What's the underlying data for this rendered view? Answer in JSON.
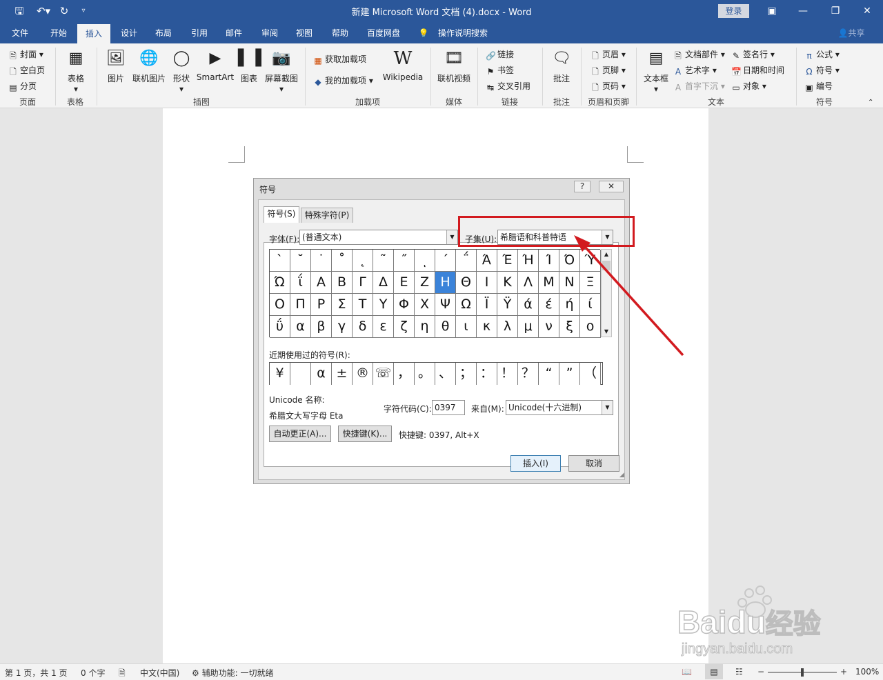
{
  "window": {
    "title": "新建 Microsoft Word 文档 (4).docx  -  Word",
    "login": "登录",
    "qat": {
      "save_icon": "save-icon",
      "undo_icon": "undo-icon",
      "redo_icon": "redo-icon",
      "customize_icon": "customize-qat-icon"
    },
    "controls": {
      "ribbon_display": "ribbon-display-icon",
      "minimize": "minimize-icon",
      "restore": "restore-icon",
      "close": "close-icon"
    }
  },
  "tabs": [
    "文件",
    "开始",
    "插入",
    "设计",
    "布局",
    "引用",
    "邮件",
    "审阅",
    "视图",
    "帮助",
    "百度网盘",
    "操作说明搜索"
  ],
  "share": "共享",
  "ribbon": {
    "pages": {
      "label": "页面",
      "cover": "封面",
      "blank": "空白页",
      "break": "分页"
    },
    "tables": {
      "label": "表格",
      "table": "表格"
    },
    "illustrations": {
      "label": "插图",
      "picture": "图片",
      "online_picture": "联机图片",
      "shapes": "形状",
      "smartart": "SmartArt",
      "chart": "图表",
      "screenshot": "屏幕截图"
    },
    "addins": {
      "label": "加载项",
      "get": "获取加载项",
      "mine": "我的加载项",
      "wikipedia": "Wikipedia",
      "wiki_glyph": "W"
    },
    "media": {
      "label": "媒体",
      "online_video": "联机视频"
    },
    "links": {
      "label": "链接",
      "link": "链接",
      "bookmark": "书签",
      "cross_ref": "交叉引用"
    },
    "comments": {
      "label": "批注",
      "comment": "批注"
    },
    "header_footer": {
      "label": "页眉和页脚",
      "header": "页眉",
      "footer": "页脚",
      "page_number": "页码"
    },
    "text": {
      "label": "文本",
      "textbox": "文本框",
      "quick_parts": "文档部件",
      "wordart": "艺术字",
      "dropcap": "首字下沉",
      "signature": "签名行",
      "datetime": "日期和时间",
      "object": "对象"
    },
    "symbols": {
      "label": "符号",
      "equation": "公式",
      "symbol": "符号",
      "numbering": "编号"
    }
  },
  "dialog": {
    "title": "符号",
    "help": "?",
    "close": "✕",
    "tab_symbols": "符号(S)",
    "tab_special": "特殊字符(P)",
    "font_label": "字体(F):",
    "font_value": "(普通文本)",
    "subset_label": "子集(U):",
    "subset_value": "希腊语和科普特语",
    "grid": [
      [
        "`",
        "˘",
        "˙",
        "˚",
        "˛",
        "˜",
        "˝",
        "ͺ",
        "΄",
        "΅",
        "Ά",
        "Έ",
        "Ή",
        "Ί",
        "Ό",
        "Ύ"
      ],
      [
        "Ώ",
        "ΐ",
        "Α",
        "Β",
        "Γ",
        "Δ",
        "Ε",
        "Ζ",
        "Η",
        "Θ",
        "Ι",
        "Κ",
        "Λ",
        "Μ",
        "Ν",
        "Ξ"
      ],
      [
        "Ο",
        "Π",
        "Ρ",
        "Σ",
        "Τ",
        "Υ",
        "Φ",
        "Χ",
        "Ψ",
        "Ω",
        "Ϊ",
        "Ϋ",
        "ά",
        "έ",
        "ή",
        "ί"
      ],
      [
        "ΰ",
        "α",
        "β",
        "γ",
        "δ",
        "ε",
        "ζ",
        "η",
        "θ",
        "ι",
        "κ",
        "λ",
        "μ",
        "ν",
        "ξ",
        "ο"
      ]
    ],
    "selected": {
      "row": 1,
      "col": 8
    },
    "recent_label": "近期使用过的符号(R):",
    "recent": [
      "¥",
      " ",
      "α",
      "±",
      "®",
      "☏",
      "，",
      "。",
      "、",
      "；",
      "：",
      "！",
      "？",
      "“",
      "”",
      "（"
    ],
    "unicode_name_label": "Unicode 名称:",
    "unicode_name_value": "希腊文大写字母 Eta",
    "char_code_label": "字符代码(C):",
    "char_code_value": "0397",
    "from_label": "来自(M):",
    "from_value": "Unicode(十六进制)",
    "autocorrect": "自动更正(A)...",
    "shortcut_key": "快捷键(K)...",
    "shortcut_text": "快捷键: 0397, Alt+X",
    "insert": "插入(I)",
    "cancel": "取消"
  },
  "status": {
    "page": "第 1 页，共 1 页",
    "words": "0 个字",
    "lang": "中文(中国)",
    "accessibility": "辅助功能: 一切就绪",
    "zoom": "100%",
    "zoom_level": 1.0
  },
  "watermark": {
    "brand": "Bai",
    "brand2": "du",
    "cn": "经验",
    "url": "jingyan.baidu.com"
  },
  "colors": {
    "titlebar": "#2b579a",
    "annotation": "#d21a1f",
    "selection": "#3b83d9"
  }
}
